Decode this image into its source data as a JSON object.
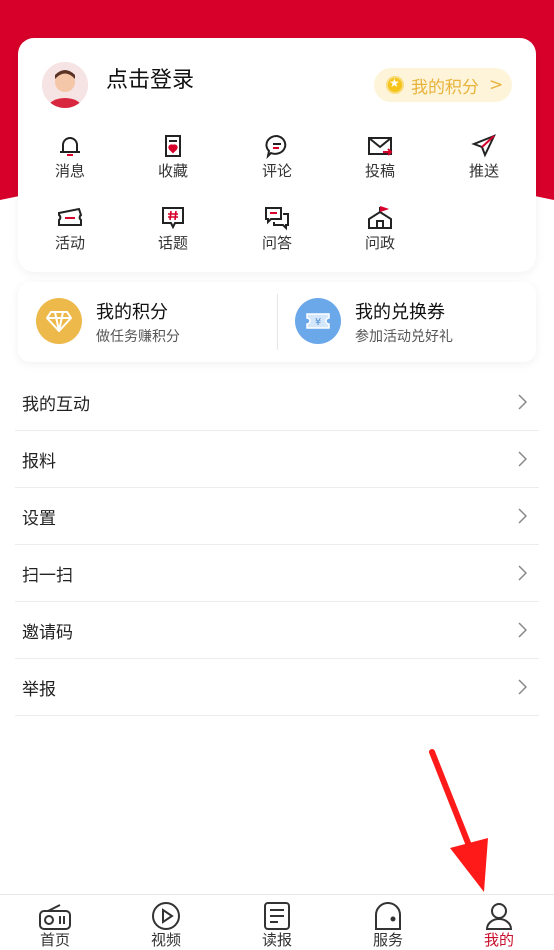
{
  "profile": {
    "login_text": "点击登录",
    "points_pill": "我的积分",
    "points_arrow": ">"
  },
  "grid": [
    {
      "label": "消息",
      "icon": "bell-icon"
    },
    {
      "label": "收藏",
      "icon": "favorite-icon"
    },
    {
      "label": "评论",
      "icon": "comment-icon"
    },
    {
      "label": "投稿",
      "icon": "mail-icon"
    },
    {
      "label": "推送",
      "icon": "send-icon"
    },
    {
      "label": "活动",
      "icon": "ticket-icon"
    },
    {
      "label": "话题",
      "icon": "topic-icon"
    },
    {
      "label": "问答",
      "icon": "qa-icon"
    },
    {
      "label": "问政",
      "icon": "government-icon"
    }
  ],
  "points_card": {
    "points_title": "我的积分",
    "points_sub": "做任务赚积分",
    "coupon_title": "我的兑换券",
    "coupon_sub": "参加活动兑好礼",
    "coupon_symbol": "¥"
  },
  "menu": [
    {
      "label": "我的互动"
    },
    {
      "label": "报料"
    },
    {
      "label": "设置"
    },
    {
      "label": "扫一扫"
    },
    {
      "label": "邀请码"
    },
    {
      "label": "举报"
    }
  ],
  "tabs": [
    {
      "label": "首页",
      "icon": "radio-icon"
    },
    {
      "label": "视频",
      "icon": "play-icon"
    },
    {
      "label": "读报",
      "icon": "newspaper-icon"
    },
    {
      "label": "服务",
      "icon": "service-icon"
    },
    {
      "label": "我的",
      "icon": "user-icon",
      "active": true
    }
  ],
  "colors": {
    "brand_red": "#d7002a",
    "active_tab": "#c8102e",
    "points_gold": "#e8b33a",
    "coupon_blue": "#6aa8ea"
  }
}
